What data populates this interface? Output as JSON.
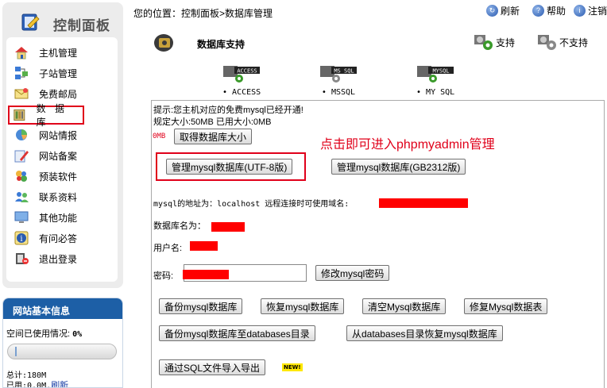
{
  "sidebar": {
    "title": "控制面板",
    "items": [
      {
        "label": "主机管理",
        "icon": "house-icon"
      },
      {
        "label": "子站管理",
        "icon": "sitemap-icon"
      },
      {
        "label": "免费邮局",
        "icon": "envelope-icon"
      },
      {
        "label": "数 据 库",
        "icon": "database-icon",
        "active": true
      },
      {
        "label": "网站情报",
        "icon": "chart-icon"
      },
      {
        "label": "网站备案",
        "icon": "pen-icon"
      },
      {
        "label": "预装软件",
        "icon": "puzzle-icon"
      },
      {
        "label": "联系资料",
        "icon": "contacts-icon"
      },
      {
        "label": "其他功能",
        "icon": "monitor-icon"
      },
      {
        "label": "有问必答",
        "icon": "info-icon"
      },
      {
        "label": "退出登录",
        "icon": "logout-icon"
      }
    ]
  },
  "basic_info": {
    "title": "网站基本信息",
    "space_label": "空间已使用情况:",
    "space_value": "0%",
    "space_fraction": 0.0,
    "total": "总计:180M",
    "used_prefix": "已用:0.0M,",
    "refresh_link": "刷新"
  },
  "topbar": {
    "breadcrumb": "您的位置：控制面板>数据库管理",
    "refresh": "刷新",
    "help": "帮助",
    "logout": "注销"
  },
  "header": {
    "title": "数据库支持",
    "supported": "支持",
    "unsupported": "不支持"
  },
  "db_types": [
    {
      "badge": "ACCESS",
      "name": "ACCESS"
    },
    {
      "badge": "MS SQL",
      "name": "MSSQL"
    },
    {
      "badge": "MYSQL",
      "name": "MY SQL"
    }
  ],
  "main": {
    "notice1": "提示:您主机对应的免费mysql已经开通!",
    "notice2": "规定大小:50MB 已用大小:0MB",
    "size_zero": "0MB",
    "get_size_button": "取得数据库大小",
    "annotation": "点击即可进入phpmyadmin管理",
    "manage_utf8_button": "管理mysql数据库(UTF-8版)",
    "manage_gb_button": "管理mysql数据库(GB2312版)",
    "address_label": "mysql的地址为：localhost 远程连接时可使用域名:",
    "dbname_label": "数据库名为：",
    "username_label": "用户名:",
    "password_label": "密码:",
    "change_password_button": "修改mysql密码",
    "backup_button": "备份mysql数据库",
    "restore_button": "恢复mysql数据库",
    "clear_button": "清空Mysql数据库",
    "repair_button": "修复Mysql数据表",
    "backup_to_dir_button": "备份mysql数据库至databases目录",
    "restore_from_dir_button": "从databases目录恢复mysql数据库",
    "sql_import_button": "通过SQL文件导入导出",
    "new_badge": "NEW!"
  }
}
